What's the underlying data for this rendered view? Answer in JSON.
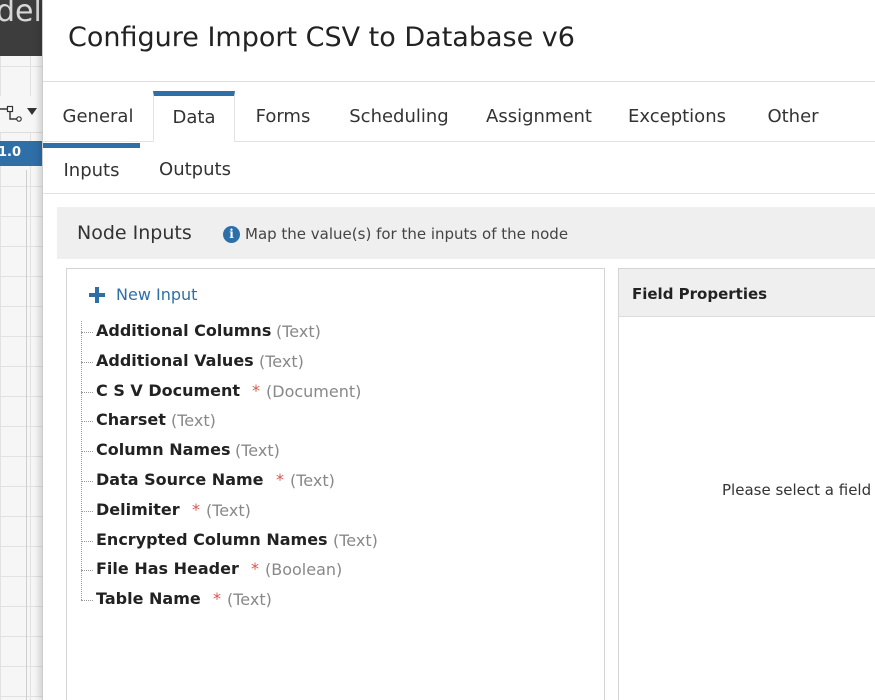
{
  "background": {
    "title_fragment": "dele",
    "chip_label": "1.0"
  },
  "modal": {
    "title": "Configure Import CSV to Database v6"
  },
  "tabs": [
    {
      "label": "General",
      "active": false
    },
    {
      "label": "Data",
      "active": true
    },
    {
      "label": "Forms",
      "active": false
    },
    {
      "label": "Scheduling",
      "active": false
    },
    {
      "label": "Assignment",
      "active": false
    },
    {
      "label": "Exceptions",
      "active": false
    },
    {
      "label": "Other",
      "active": false
    }
  ],
  "subtabs": [
    {
      "label": "Inputs",
      "active": true
    },
    {
      "label": "Outputs",
      "active": false
    }
  ],
  "section": {
    "title": "Node Inputs",
    "description": "Map the value(s) for the inputs of the node"
  },
  "inputs_panel": {
    "new_input_label": "New Input",
    "items": [
      {
        "name": "Additional Columns",
        "required": false,
        "type": "(Text)"
      },
      {
        "name": "Additional Values",
        "required": false,
        "type": "(Text)"
      },
      {
        "name": "C S V Document",
        "required": true,
        "type": "(Document)"
      },
      {
        "name": "Charset",
        "required": false,
        "type": "(Text)"
      },
      {
        "name": "Column Names",
        "required": false,
        "type": "(Text)"
      },
      {
        "name": "Data Source Name",
        "required": true,
        "type": "(Text)"
      },
      {
        "name": "Delimiter",
        "required": true,
        "type": "(Text)"
      },
      {
        "name": "Encrypted Column Names",
        "required": false,
        "type": "(Text)"
      },
      {
        "name": "File Has Header",
        "required": true,
        "type": "(Boolean)"
      },
      {
        "name": "Table Name",
        "required": true,
        "type": "(Text)"
      }
    ],
    "required_marker": "*"
  },
  "props_panel": {
    "title": "Field Properties",
    "empty_message": "Please select a field to"
  },
  "colors": {
    "accent": "#2f6fa8",
    "required": "#d9534f"
  }
}
